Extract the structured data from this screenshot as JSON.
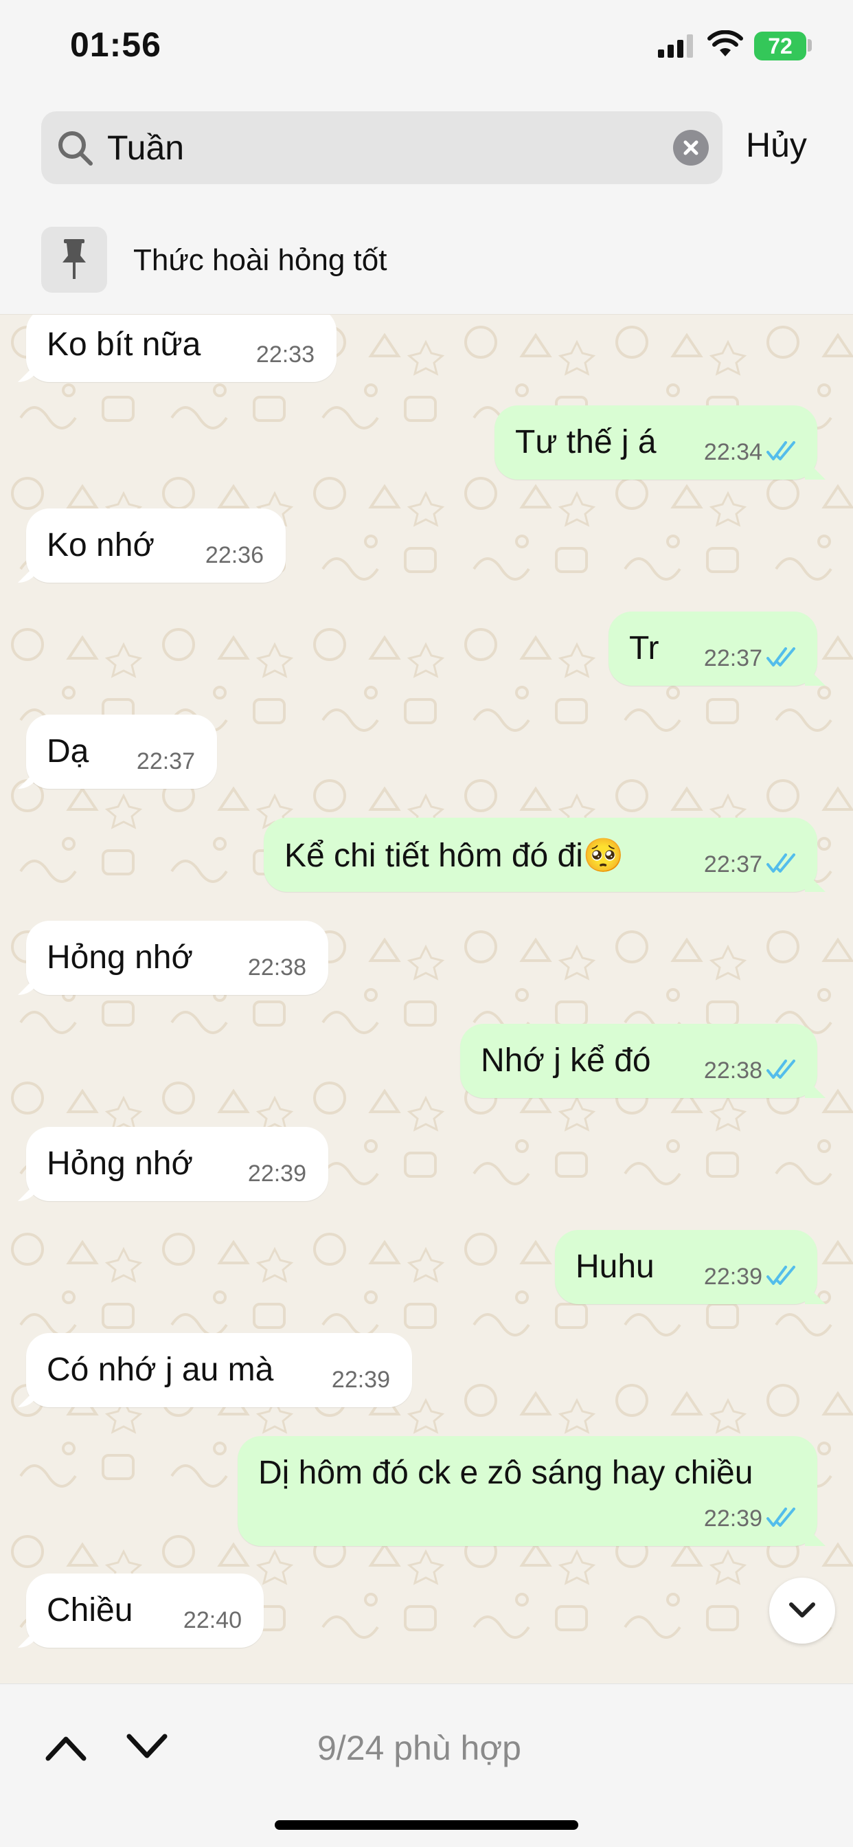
{
  "status_bar": {
    "time": "01:56",
    "battery": "72"
  },
  "search": {
    "query": "Tuần",
    "cancel_label": "Hủy"
  },
  "pinned": {
    "text": "Thức hoài hỏng tốt"
  },
  "messages": [
    {
      "direction": "in",
      "text": "Ko bít nữa",
      "time": "22:33"
    },
    {
      "direction": "out",
      "text": "Tư thế j á",
      "time": "22:34"
    },
    {
      "direction": "in",
      "text": "Ko nhớ",
      "time": "22:36"
    },
    {
      "direction": "out",
      "text": "Tr",
      "time": "22:37"
    },
    {
      "direction": "in",
      "text": "Dạ",
      "time": "22:37"
    },
    {
      "direction": "out",
      "text": "Kể chi tiết hôm đó đi🥺",
      "time": "22:37"
    },
    {
      "direction": "in",
      "text": "Hỏng nhớ",
      "time": "22:38"
    },
    {
      "direction": "out",
      "text": "Nhớ j kể đó",
      "time": "22:38"
    },
    {
      "direction": "in",
      "text": "Hỏng nhớ",
      "time": "22:39"
    },
    {
      "direction": "out",
      "text": "Huhu",
      "time": "22:39"
    },
    {
      "direction": "in",
      "text": "Có nhớ j au mà",
      "time": "22:39"
    },
    {
      "direction": "out",
      "text": "Dị hôm đó ck e zô sáng hay chiều",
      "time": "22:39"
    },
    {
      "direction": "in",
      "text": "Chiều",
      "time": "22:40"
    }
  ],
  "footer": {
    "match_count": "9/24 phù hợp"
  },
  "colors": {
    "outgoing_bubble": "#d9fdd3",
    "incoming_bubble": "#ffffff",
    "read_ticks": "#53bdeb",
    "chat_background": "#f3efe7",
    "battery": "#34c759"
  }
}
